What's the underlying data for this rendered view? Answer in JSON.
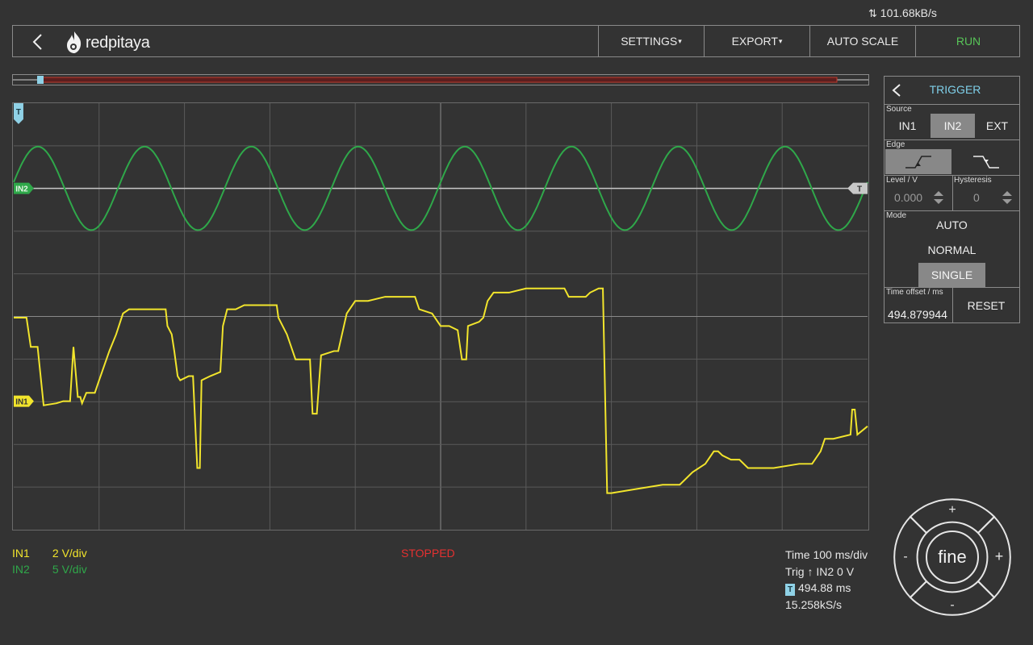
{
  "status_bar": {
    "transfer_rate": "101.68kB/s"
  },
  "header": {
    "logo_text": "redpitaya",
    "menu": {
      "settings": "SETTINGS",
      "export": "EXPORT",
      "auto_scale": "AUTO SCALE",
      "run": "RUN"
    }
  },
  "plot": {
    "channel_markers": {
      "in2": "IN2",
      "in1": "IN1",
      "trigger": "T"
    },
    "grid": {
      "divisions_x": 10,
      "divisions_y": 10
    },
    "colors": {
      "in1": "#f2e52c",
      "in2": "#2fa84a",
      "trigger": "#8fd1e6",
      "grid": "#6a6a6a",
      "trigger_level_line": "#c8c8c8"
    }
  },
  "chart_data": {
    "type": "line",
    "xlabel": "",
    "ylabel": "",
    "x_divisions": 10,
    "y_divisions": 10,
    "series": [
      {
        "name": "IN2",
        "color": "#2fa84a",
        "description_of_values": "sine wave, roughly 8 cycles across screen",
        "y": [
          0,
          1,
          0,
          -1,
          0,
          1,
          0,
          -1,
          0,
          1,
          0,
          -1,
          0,
          1,
          0,
          -1,
          0,
          1,
          0,
          -1,
          0,
          1,
          0,
          -1,
          0,
          1,
          0,
          -1,
          0,
          1,
          0,
          -1,
          0
        ]
      },
      {
        "name": "IN1",
        "color": "#f2e52c",
        "points": [
          [
            0,
            2.0
          ],
          [
            0.15,
            2.0
          ],
          [
            0.2,
            1.3
          ],
          [
            0.28,
            1.3
          ],
          [
            0.35,
            -0.1
          ],
          [
            0.5,
            -0.05
          ],
          [
            0.58,
            0
          ],
          [
            0.66,
            0
          ],
          [
            0.7,
            1.3
          ],
          [
            0.75,
            0.1
          ],
          [
            0.78,
            0.1
          ],
          [
            0.8,
            -0.05
          ],
          [
            0.85,
            0.2
          ],
          [
            0.95,
            0.2
          ],
          [
            1.0,
            0.5
          ],
          [
            1.12,
            1.2
          ],
          [
            1.2,
            1.6
          ],
          [
            1.28,
            2.1
          ],
          [
            1.35,
            2.2
          ],
          [
            1.5,
            2.2
          ],
          [
            1.6,
            2.2
          ],
          [
            1.68,
            2.2
          ],
          [
            1.73,
            2.2
          ],
          [
            1.78,
            2.2
          ],
          [
            1.8,
            1.8
          ],
          [
            1.85,
            1.6
          ],
          [
            1.88,
            1.2
          ],
          [
            1.92,
            0.6
          ],
          [
            1.95,
            0.5
          ],
          [
            2.05,
            0.6
          ],
          [
            2.1,
            0.6
          ],
          [
            2.15,
            -1.6
          ],
          [
            2.18,
            -1.6
          ],
          [
            2.2,
            0.5
          ],
          [
            2.3,
            0.6
          ],
          [
            2.42,
            0.7
          ],
          [
            2.45,
            1.8
          ],
          [
            2.5,
            2.2
          ],
          [
            2.6,
            2.2
          ],
          [
            2.7,
            2.3
          ],
          [
            2.85,
            2.3
          ],
          [
            3.0,
            2.3
          ],
          [
            3.08,
            2.3
          ],
          [
            3.1,
            2.0
          ],
          [
            3.2,
            1.6
          ],
          [
            3.3,
            1.0
          ],
          [
            3.4,
            1.0
          ],
          [
            3.47,
            1.0
          ],
          [
            3.5,
            -0.3
          ],
          [
            3.55,
            -0.3
          ],
          [
            3.6,
            1.1
          ],
          [
            3.75,
            1.2
          ],
          [
            3.8,
            1.2
          ],
          [
            3.9,
            2.1
          ],
          [
            4.0,
            2.4
          ],
          [
            4.15,
            2.4
          ],
          [
            4.35,
            2.5
          ],
          [
            4.55,
            2.5
          ],
          [
            4.7,
            2.5
          ],
          [
            4.75,
            2.2
          ],
          [
            4.9,
            2.1
          ],
          [
            5.0,
            1.8
          ],
          [
            5.1,
            1.8
          ],
          [
            5.2,
            1.7
          ],
          [
            5.25,
            1.0
          ],
          [
            5.3,
            1.0
          ],
          [
            5.32,
            1.8
          ],
          [
            5.45,
            1.9
          ],
          [
            5.5,
            2.0
          ],
          [
            5.55,
            2.4
          ],
          [
            5.62,
            2.6
          ],
          [
            5.8,
            2.6
          ],
          [
            6.0,
            2.7
          ],
          [
            6.3,
            2.7
          ],
          [
            6.45,
            2.7
          ],
          [
            6.5,
            2.5
          ],
          [
            6.6,
            2.5
          ],
          [
            6.7,
            2.5
          ],
          [
            6.75,
            2.6
          ],
          [
            6.85,
            2.7
          ],
          [
            6.9,
            2.7
          ],
          [
            6.95,
            -2.2
          ],
          [
            7.0,
            -2.2
          ],
          [
            7.3,
            -2.1
          ],
          [
            7.6,
            -2.0
          ],
          [
            7.8,
            -2.0
          ],
          [
            7.95,
            -1.7
          ],
          [
            8.1,
            -1.5
          ],
          [
            8.2,
            -1.2
          ],
          [
            8.25,
            -1.2
          ],
          [
            8.3,
            -1.3
          ],
          [
            8.4,
            -1.4
          ],
          [
            8.5,
            -1.4
          ],
          [
            8.6,
            -1.6
          ],
          [
            8.9,
            -1.6
          ],
          [
            9.2,
            -1.5
          ],
          [
            9.35,
            -1.5
          ],
          [
            9.45,
            -1.2
          ],
          [
            9.5,
            -0.9
          ],
          [
            9.6,
            -0.9
          ],
          [
            9.8,
            -0.8
          ],
          [
            9.82,
            -0.2
          ],
          [
            9.85,
            -0.2
          ],
          [
            9.88,
            -0.8
          ],
          [
            10,
            -0.6
          ]
        ]
      }
    ]
  },
  "trigger": {
    "back_label": "TRIGGER",
    "source_label": "Source",
    "sources": [
      "IN1",
      "IN2",
      "EXT"
    ],
    "selected_source": "IN2",
    "edge_label": "Edge",
    "selected_edge": "rising",
    "level_label": "Level / V",
    "level_value": "0.000",
    "hysteresis_label": "Hysteresis",
    "hysteresis_value": "0",
    "mode_label": "Mode",
    "modes": [
      "AUTO",
      "NORMAL",
      "SINGLE"
    ],
    "selected_mode": "SINGLE",
    "time_offset_label": "Time offset / ms",
    "time_offset_value": "494.879944",
    "reset_label": "RESET"
  },
  "channels": {
    "in1": {
      "label": "IN1",
      "scale": "2 V/div"
    },
    "in2": {
      "label": "IN2",
      "scale": "5 V/div"
    }
  },
  "status": "STOPPED",
  "info": {
    "time": "Time 100 ms/div",
    "trig": "Trig ↑ IN2 0 V",
    "offset": "494.88 ms",
    "offset_marker": "T",
    "sample_rate": "15.258kS/s"
  },
  "dial": {
    "center_label": "fine",
    "up": "+",
    "down": "-",
    "left": "-",
    "right": "+"
  }
}
